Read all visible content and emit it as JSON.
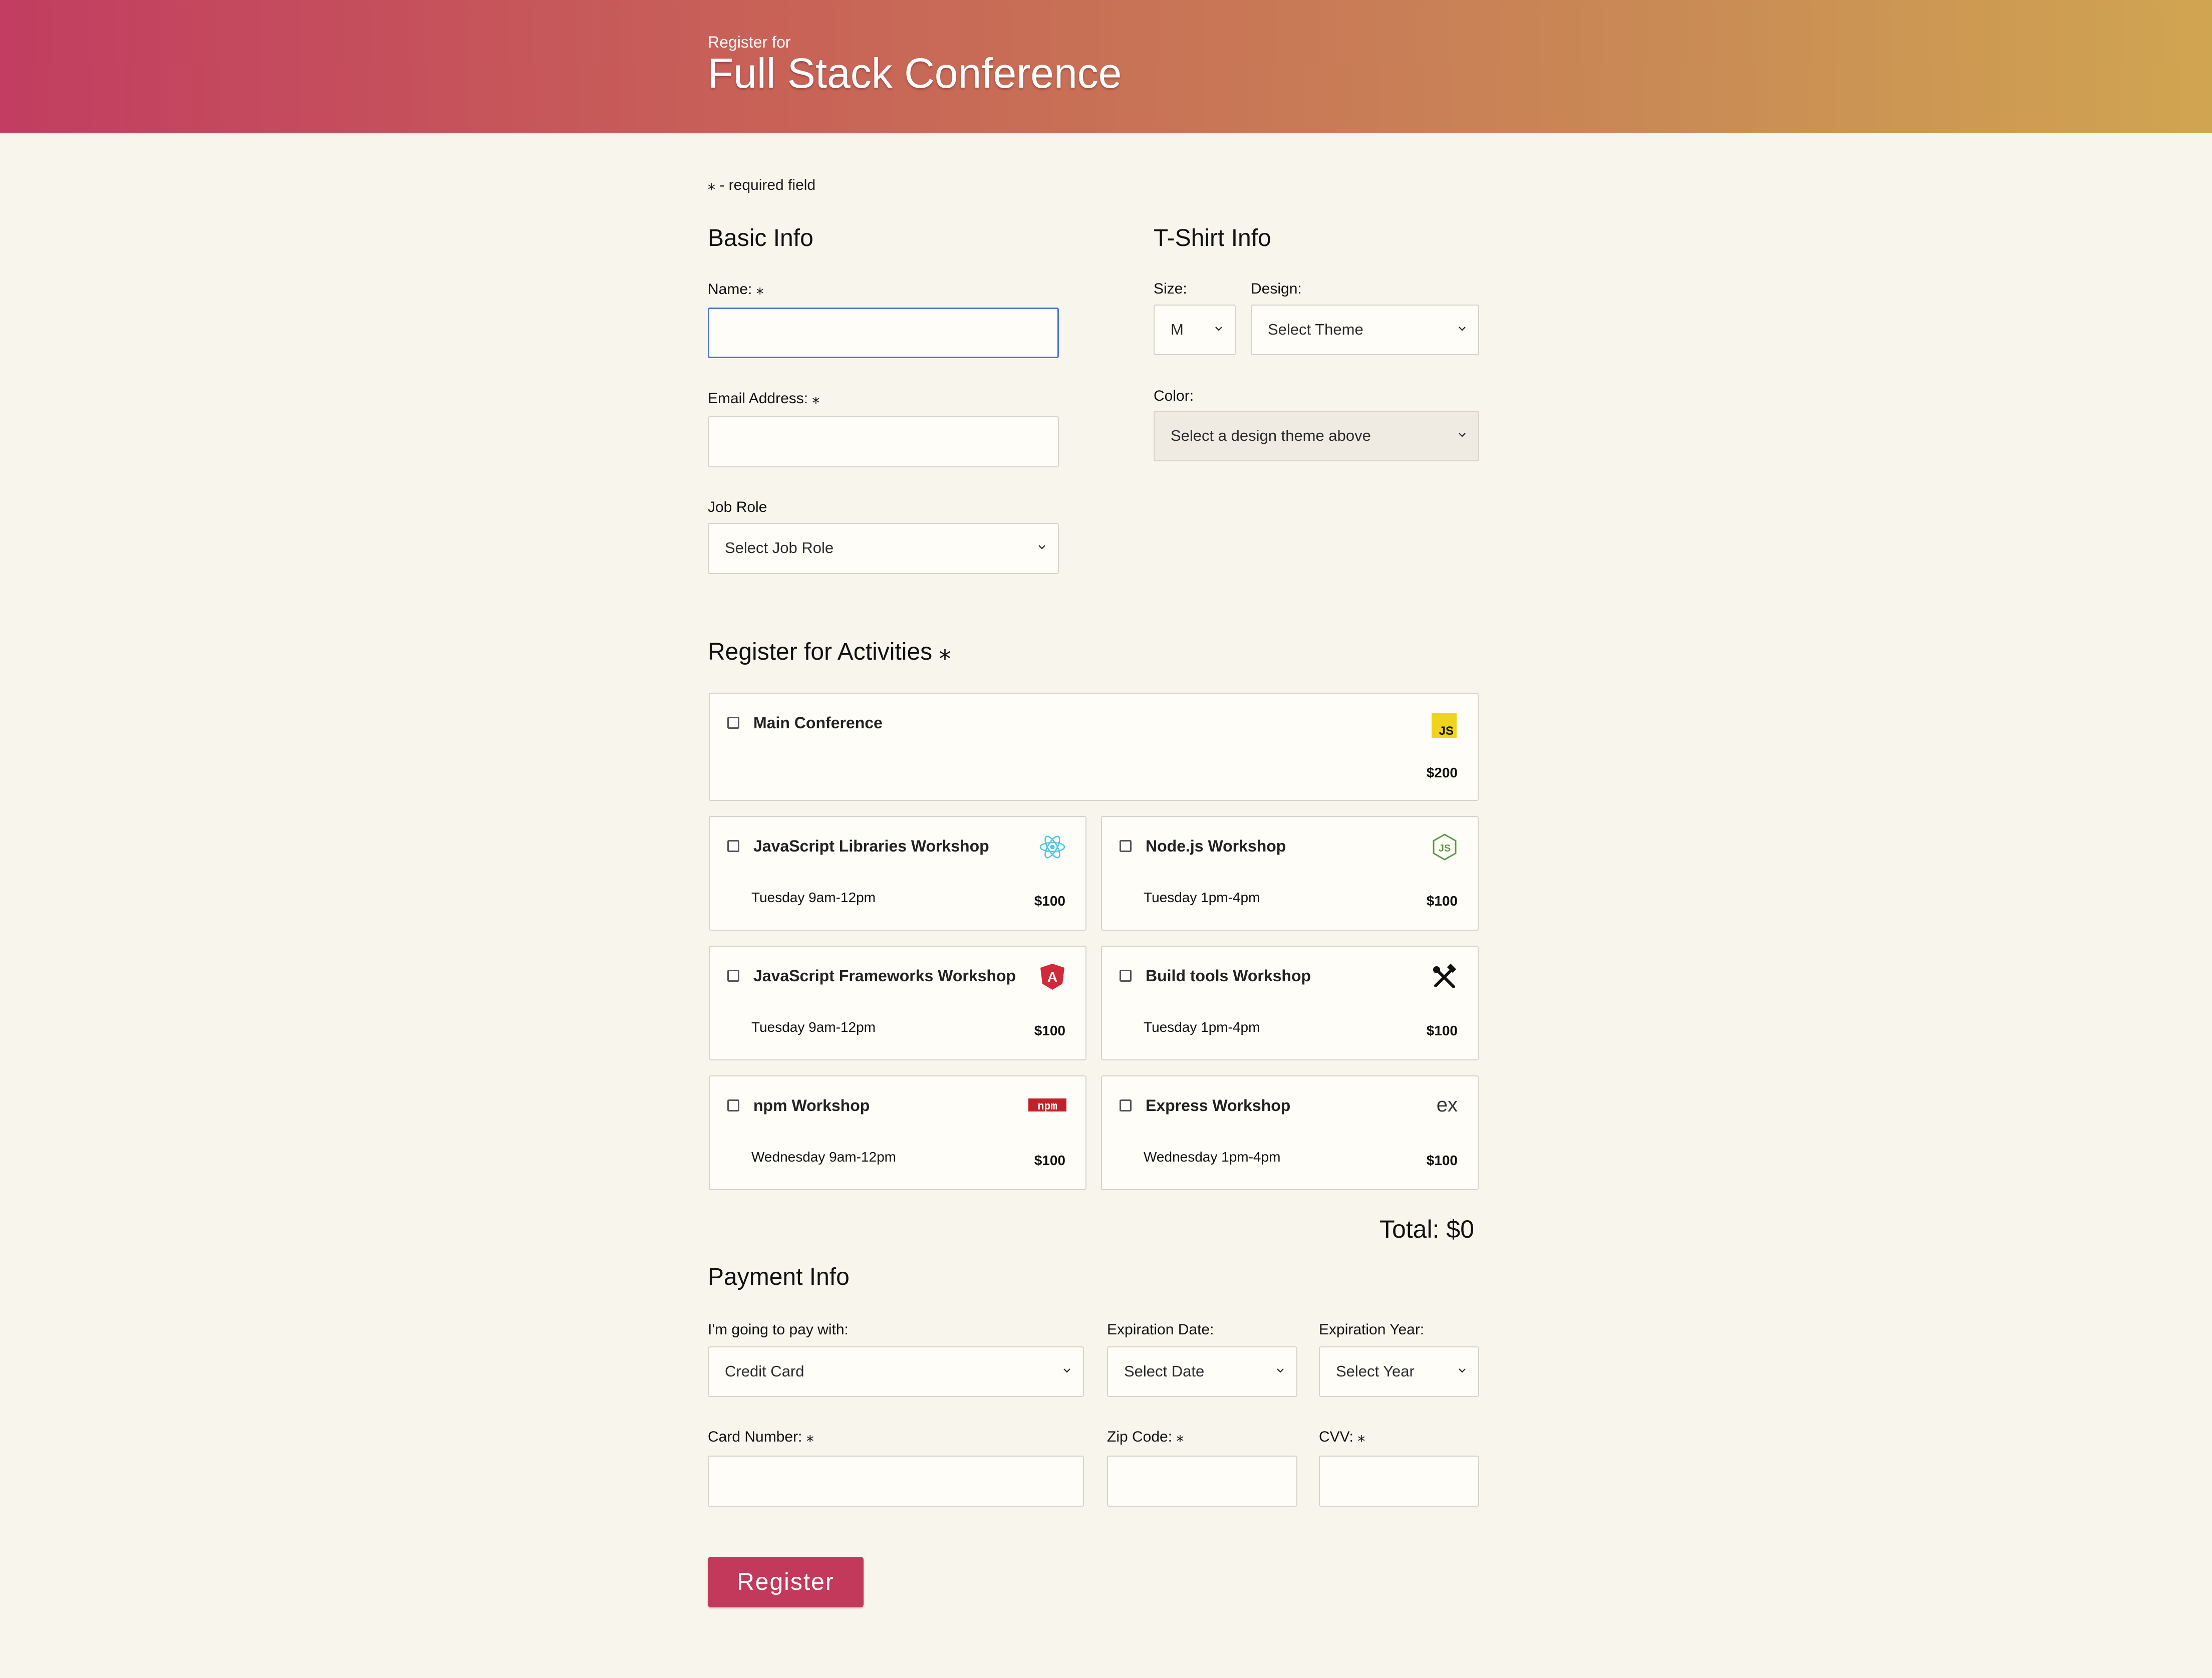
{
  "header": {
    "subtitle": "Register for",
    "title": "Full Stack Conference"
  },
  "required_note": "⁎ - required field",
  "basic": {
    "heading": "Basic Info",
    "name_label": "Name: ⁎",
    "email_label": "Email Address: ⁎",
    "job_label": "Job Role",
    "job_select": "Select Job Role"
  },
  "tshirt": {
    "heading": "T-Shirt Info",
    "size_label": "Size:",
    "size_value": "M",
    "design_label": "Design:",
    "design_value": "Select Theme",
    "color_label": "Color:",
    "color_value": "Select a design theme above"
  },
  "activities": {
    "heading": "Register for Activities ⁎",
    "main": {
      "name": "Main Conference",
      "price": "$200"
    },
    "items": [
      {
        "name": "JavaScript Libraries Workshop",
        "time": "Tuesday 9am-12pm",
        "price": "$100"
      },
      {
        "name": "Node.js Workshop",
        "time": "Tuesday 1pm-4pm",
        "price": "$100"
      },
      {
        "name": "JavaScript Frameworks Workshop",
        "time": "Tuesday 9am-12pm",
        "price": "$100"
      },
      {
        "name": "Build tools Workshop",
        "time": "Tuesday 1pm-4pm",
        "price": "$100"
      },
      {
        "name": "npm Workshop",
        "time": "Wednesday 9am-12pm",
        "price": "$100"
      },
      {
        "name": "Express Workshop",
        "time": "Wednesday 1pm-4pm",
        "price": "$100"
      }
    ],
    "total": "Total: $0"
  },
  "icon_text": {
    "js": "JS",
    "angular": "A",
    "npm": "npm",
    "express": "ex"
  },
  "payment": {
    "heading": "Payment Info",
    "method_label": "I'm going to pay with:",
    "method_value": "Credit Card",
    "exp_date_label": "Expiration Date:",
    "exp_date_value": "Select Date",
    "exp_year_label": "Expiration Year:",
    "exp_year_value": "Select Year",
    "card_label": "Card Number: ⁎",
    "zip_label": "Zip Code: ⁎",
    "cvv_label": "CVV: ⁎"
  },
  "register_button": "Register",
  "colors": {
    "accent": "#c3395c",
    "focus": "#4b74d6",
    "background": "#f8f5ec"
  }
}
